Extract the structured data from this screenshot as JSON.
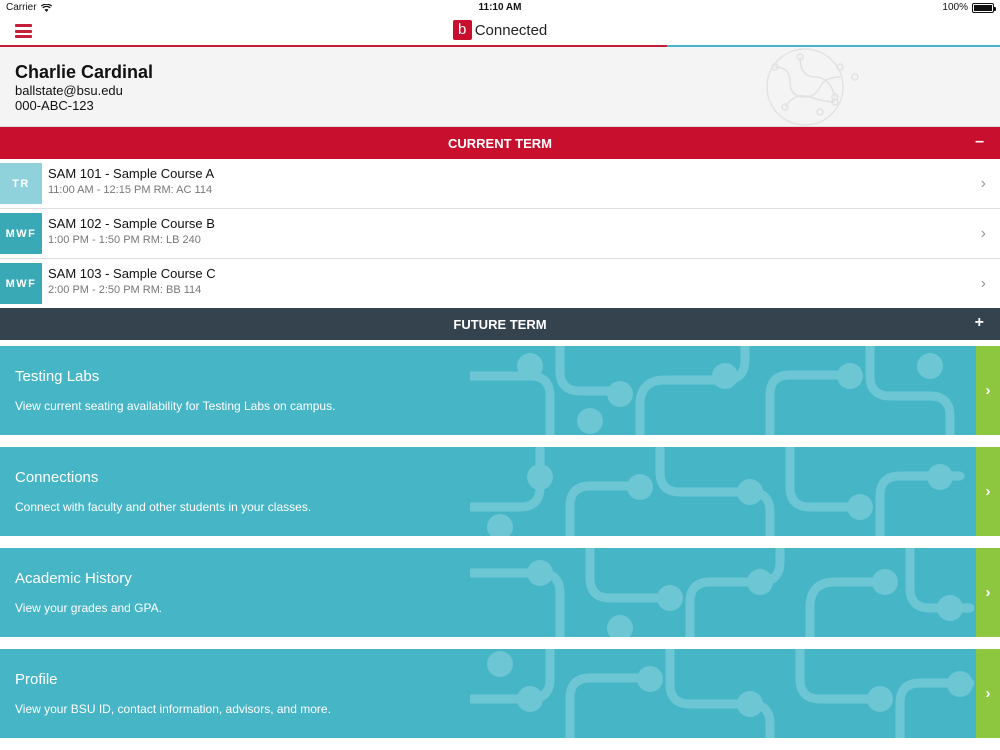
{
  "status_bar": {
    "carrier": "Carrier",
    "time": "11:10 AM",
    "battery": "100%"
  },
  "nav": {
    "logo_letter": "b",
    "app_name": "Connected",
    "menu_icon": "hamburger-menu-icon"
  },
  "user": {
    "name": "Charlie Cardinal",
    "email": "ballstate@bsu.edu",
    "id": "000-ABC-123"
  },
  "current_term": {
    "label": "CURRENT TERM",
    "toggle": "–",
    "courses": [
      {
        "days": "TR",
        "title": "SAM 101 - Sample Course A",
        "meta": "11:00 AM - 12:15 PM  RM: AC 114",
        "color": "#8fd2dc"
      },
      {
        "days": "MWF",
        "title": "SAM 102 - Sample Course B",
        "meta": "1:00 PM - 1:50 PM  RM: LB 240",
        "color": "#3aa9b6"
      },
      {
        "days": "MWF",
        "title": "SAM 103 - Sample Course C",
        "meta": "2:00 PM - 2:50 PM  RM: BB 114",
        "color": "#3aa9b6"
      }
    ]
  },
  "future_term": {
    "label": "FUTURE TERM",
    "toggle": "+"
  },
  "cards": [
    {
      "title": "Testing Labs",
      "desc": "View current seating availability for Testing Labs on campus."
    },
    {
      "title": "Connections",
      "desc": "Connect with faculty and other students in your classes."
    },
    {
      "title": "Academic History",
      "desc": "View your grades and GPA."
    },
    {
      "title": "Profile",
      "desc": "View your BSU ID, contact information, advisors, and more."
    }
  ],
  "colors": {
    "brand_red": "#c8102e",
    "teal": "#46b5c6",
    "dark_slate": "#35434f",
    "green": "#8dc63f"
  }
}
